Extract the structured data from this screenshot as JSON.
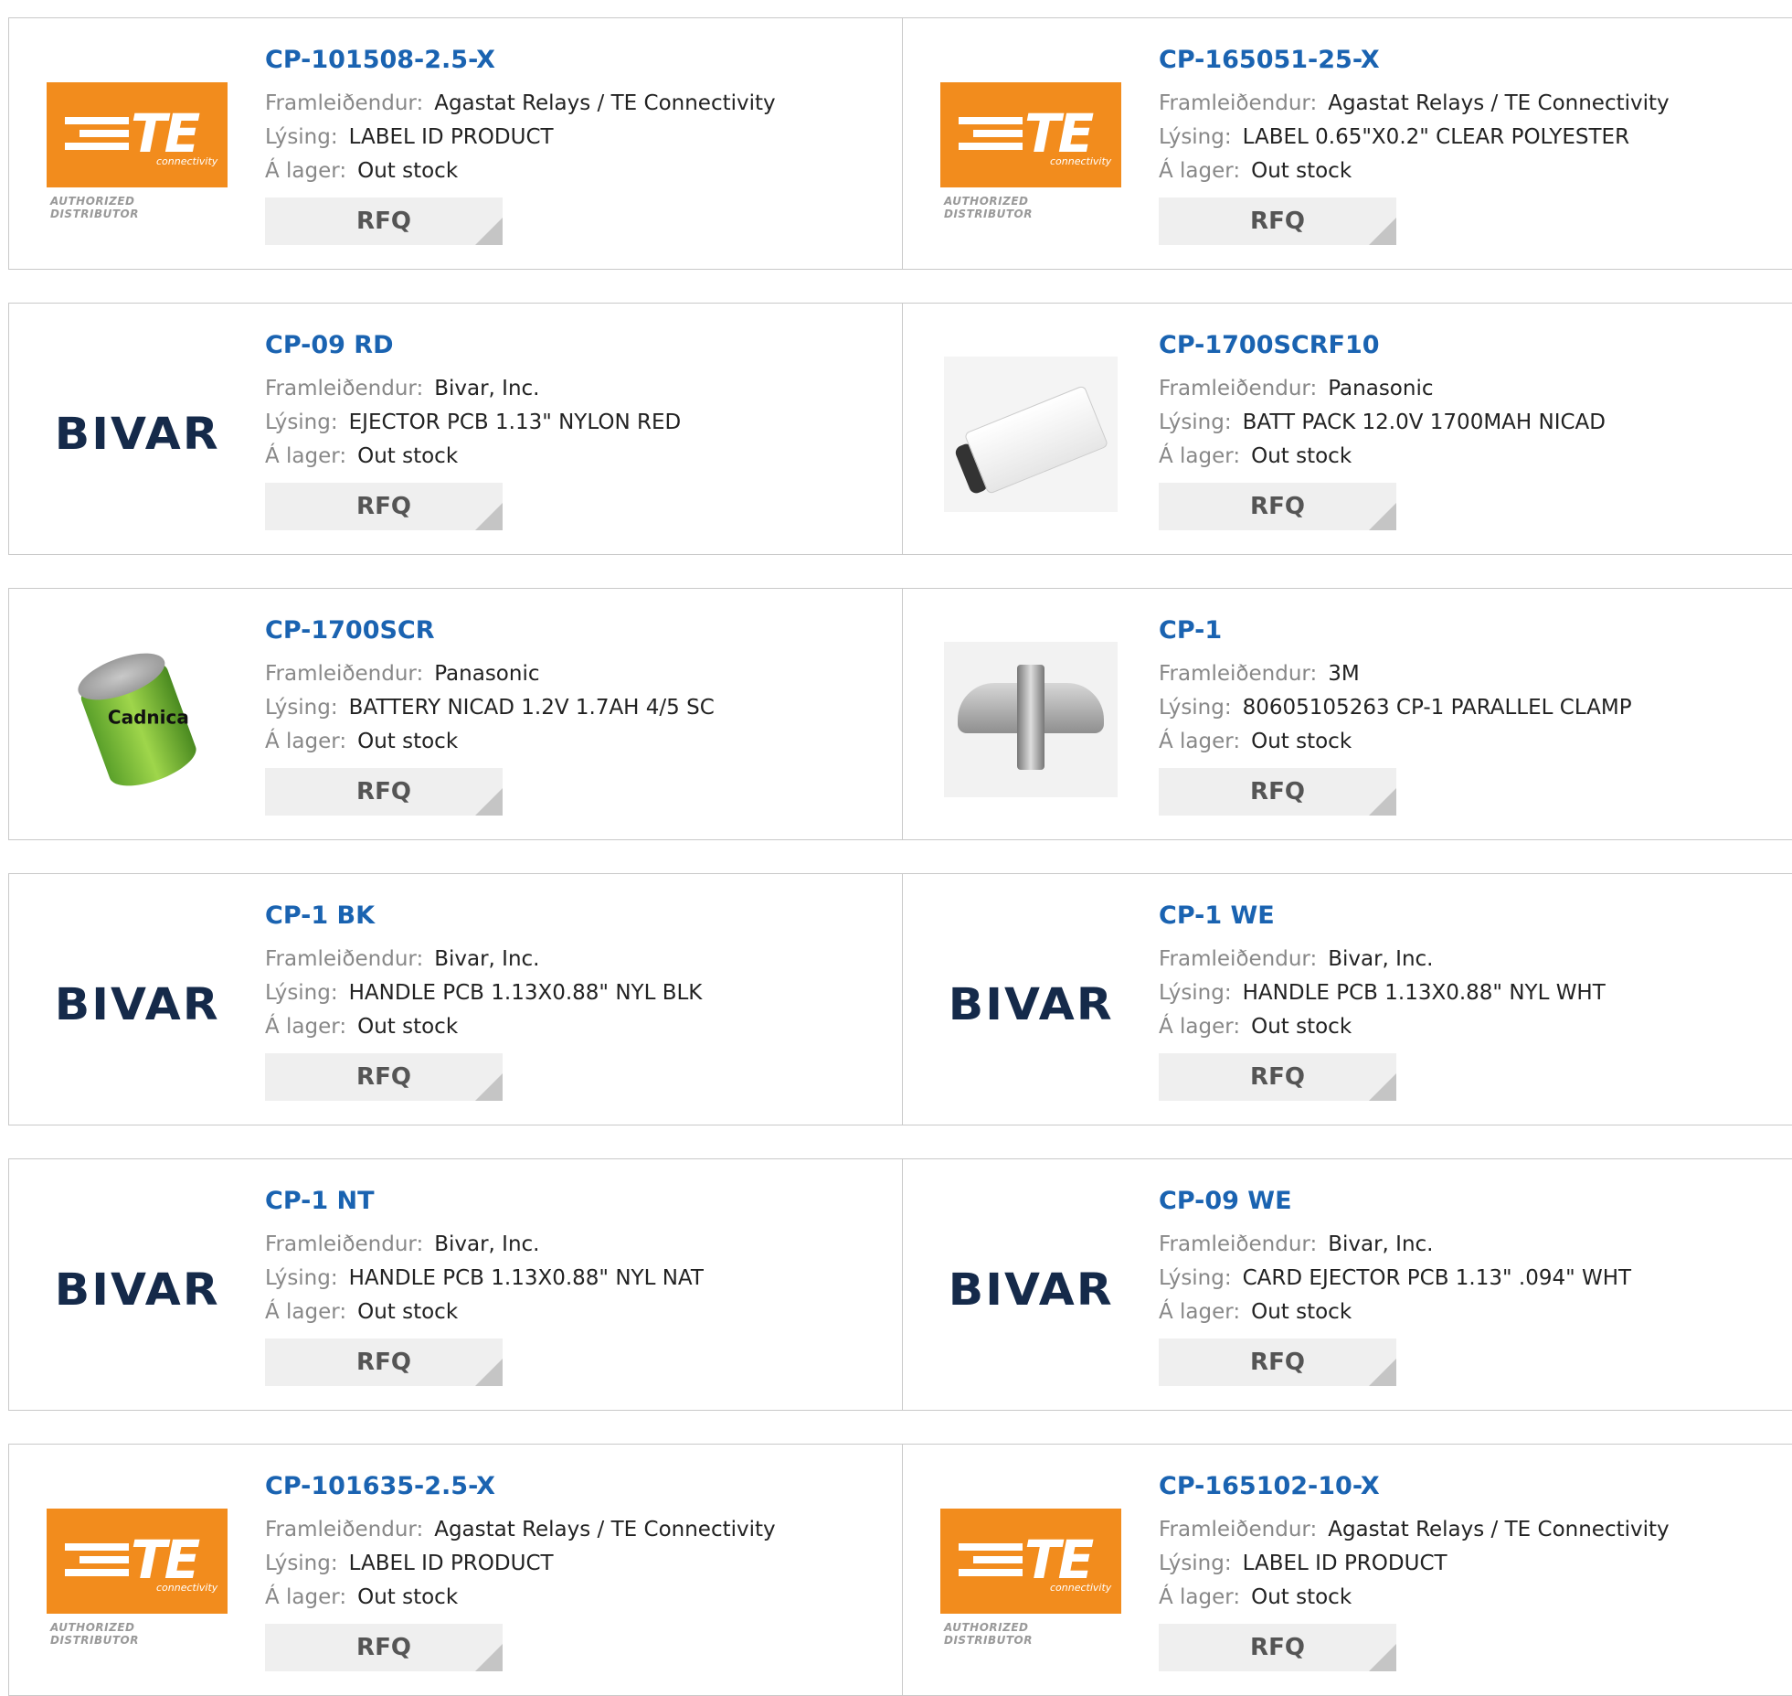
{
  "labels": {
    "manufacturer": "Framleiðendur:",
    "description": "Lýsing:",
    "stock": "Á lager:",
    "rfq": "RFQ"
  },
  "logos": {
    "te_letters": "TE",
    "te_connectivity": "connectivity",
    "te_authorized": "AUTHORIZED DISTRIBUTOR",
    "bivar": "BIVAR",
    "sanyo_cell_text": "Cadnica"
  },
  "colors": {
    "part_link": "#1a63b1",
    "te_orange": "#f28c1d",
    "bivar_navy": "#152a4a"
  },
  "products": [
    {
      "part": "CP-101508-2.5-X",
      "manufacturer": "Agastat Relays / TE Connectivity",
      "description": "LABEL ID PRODUCT",
      "stock": "Out stock",
      "image": "te-logo"
    },
    {
      "part": "CP-165051-25-X",
      "manufacturer": "Agastat Relays / TE Connectivity",
      "description": "LABEL 0.65\"X0.2\" CLEAR POLYESTER",
      "stock": "Out stock",
      "image": "te-logo"
    },
    {
      "part": "CP-09 RD",
      "manufacturer": "Bivar, Inc.",
      "description": "EJECTOR PCB 1.13\" NYLON RED",
      "stock": "Out stock",
      "image": "bivar-logo"
    },
    {
      "part": "CP-1700SCRF10",
      "manufacturer": "Panasonic",
      "description": "BATT PACK 12.0V 1700MAH NICAD",
      "stock": "Out stock",
      "image": "battery-pack-photo"
    },
    {
      "part": "CP-1700SCR",
      "manufacturer": "Panasonic",
      "description": "BATTERY NICAD 1.2V 1.7AH 4/5 SC",
      "stock": "Out stock",
      "image": "battery-cell-photo"
    },
    {
      "part": "CP-1",
      "manufacturer": "3M",
      "description": "80605105263 CP-1 PARALLEL CLAMP",
      "stock": "Out stock",
      "image": "clamp-photo"
    },
    {
      "part": "CP-1 BK",
      "manufacturer": "Bivar, Inc.",
      "description": "HANDLE PCB 1.13X0.88\" NYL BLK",
      "stock": "Out stock",
      "image": "bivar-logo"
    },
    {
      "part": "CP-1 WE",
      "manufacturer": "Bivar, Inc.",
      "description": "HANDLE PCB 1.13X0.88\" NYL WHT",
      "stock": "Out stock",
      "image": "bivar-logo"
    },
    {
      "part": "CP-1 NT",
      "manufacturer": "Bivar, Inc.",
      "description": "HANDLE PCB 1.13X0.88\" NYL NAT",
      "stock": "Out stock",
      "image": "bivar-logo"
    },
    {
      "part": "CP-09 WE",
      "manufacturer": "Bivar, Inc.",
      "description": "CARD EJECTOR PCB 1.13\" .094\" WHT",
      "stock": "Out stock",
      "image": "bivar-logo"
    },
    {
      "part": "CP-101635-2.5-X",
      "manufacturer": "Agastat Relays / TE Connectivity",
      "description": "LABEL ID PRODUCT",
      "stock": "Out stock",
      "image": "te-logo"
    },
    {
      "part": "CP-165102-10-X",
      "manufacturer": "Agastat Relays / TE Connectivity",
      "description": "LABEL ID PRODUCT",
      "stock": "Out stock",
      "image": "te-logo"
    }
  ]
}
